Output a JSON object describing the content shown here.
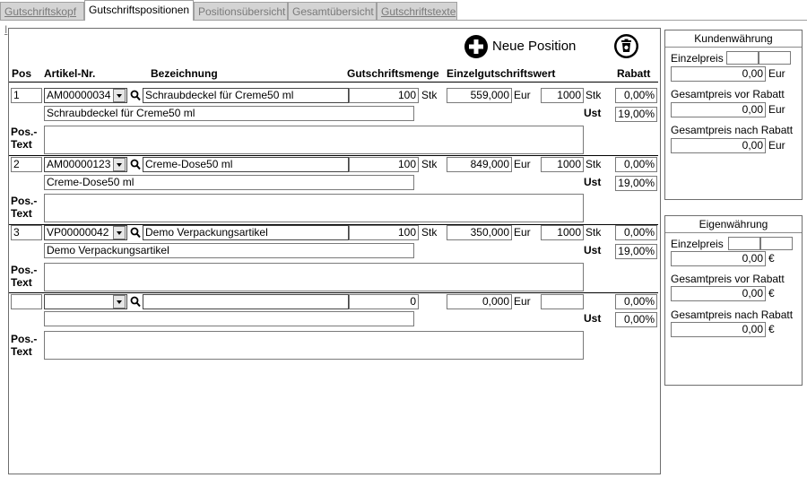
{
  "tabs": [
    {
      "label": "Gutschriftskopf I",
      "active": false
    },
    {
      "label": "Gutschriftspositionen",
      "active": true
    },
    {
      "label": "Positionsübersicht",
      "active": false
    },
    {
      "label": "Gesamtübersicht",
      "active": false
    },
    {
      "label": "Gutschriftstexte",
      "active": false
    }
  ],
  "toolbar": {
    "new_position_label": "Neue Position",
    "new_position_icon": "plus-circle-icon",
    "delete_icon": "trash-icon"
  },
  "columns": {
    "pos": "Pos",
    "artikel": "Artikel-Nr.",
    "bezeichnung": "Bezeichnung",
    "menge": "Gutschriftsmenge",
    "wert": "Einzelgutschriftswert",
    "rabatt": "Rabatt"
  },
  "labels": {
    "ust": "Ust",
    "pos_text": "Pos.-\nText"
  },
  "rows": [
    {
      "pos": "1",
      "artikel": "AM00000034",
      "bezeichnung": "Schraubdeckel für Creme50 ml",
      "menge": "100",
      "menge_unit": "Stk",
      "wert": "559,000",
      "waehrung": "Eur",
      "per": "1000",
      "per_unit": "Stk",
      "rabatt": "0,00%",
      "desc": "Schraubdeckel für Creme50 ml",
      "ust": "19,00%",
      "pos_text": ""
    },
    {
      "pos": "2",
      "artikel": "AM00000123",
      "bezeichnung": "Creme-Dose50 ml",
      "menge": "100",
      "menge_unit": "Stk",
      "wert": "849,000",
      "waehrung": "Eur",
      "per": "1000",
      "per_unit": "Stk",
      "rabatt": "0,00%",
      "desc": "Creme-Dose50 ml",
      "ust": "19,00%",
      "pos_text": ""
    },
    {
      "pos": "3",
      "artikel": "VP00000042",
      "bezeichnung": "Demo Verpackungsartikel",
      "menge": "100",
      "menge_unit": "Stk",
      "wert": "350,000",
      "waehrung": "Eur",
      "per": "1000",
      "per_unit": "Stk",
      "rabatt": "0,00%",
      "desc": "Demo Verpackungsartikel",
      "ust": "19,00%",
      "pos_text": ""
    },
    {
      "pos": "",
      "artikel": "",
      "bezeichnung": "",
      "menge": "0",
      "menge_unit": "",
      "wert": "0,000",
      "waehrung": "Eur",
      "per": "",
      "per_unit": "",
      "rabatt": "0,00%",
      "desc": "",
      "ust": "0,00%",
      "pos_text": ""
    }
  ],
  "kunden": {
    "title": "Kundenwährung",
    "einzelpreis_label": "Einzelpreis",
    "einzelpreis": "0,00",
    "gesamt_vor_label": "Gesamtpreis vor Rabatt",
    "gesamt_vor": "0,00",
    "gesamt_nach_label": "Gesamtpreis nach Rabatt",
    "gesamt_nach": "0,00",
    "currency": "Eur"
  },
  "eigen": {
    "title": "Eigenwährung",
    "einzelpreis_label": "Einzelpreis",
    "einzelpreis": "0,00",
    "gesamt_vor_label": "Gesamtpreis vor Rabatt",
    "gesamt_vor": "0,00",
    "gesamt_nach_label": "Gesamtpreis nach Rabatt",
    "gesamt_nach": "0,00",
    "currency": "€"
  }
}
